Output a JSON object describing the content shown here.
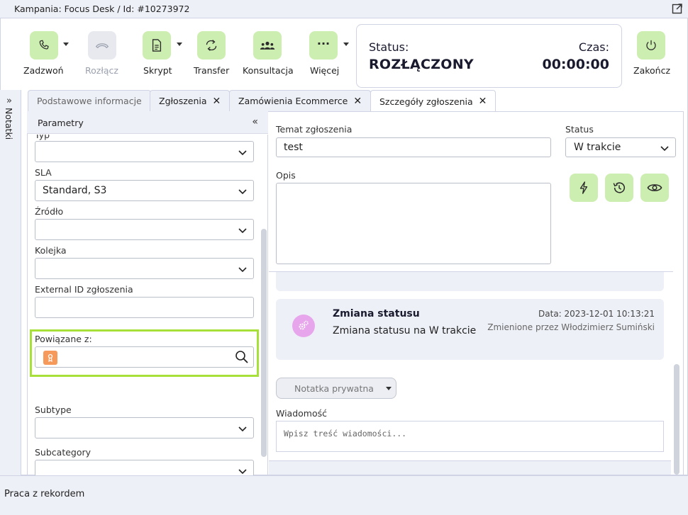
{
  "window": {
    "title": "Kampania: Focus Desk / Id: #10273972"
  },
  "toolbar": {
    "call_label": "Zadzwoń",
    "hangup_label": "Rozłącz",
    "script_label": "Skrypt",
    "transfer_label": "Transfer",
    "consult_label": "Konsultacja",
    "more_label": "Więcej",
    "end_label": "Zakończ"
  },
  "status_box": {
    "status_label": "Status:",
    "status_value": "ROZŁĄCZONY",
    "time_label": "Czas:",
    "time_value": "00:00:00"
  },
  "notes_tab": {
    "label": "Notatki"
  },
  "tabs": [
    {
      "label": "Podstawowe informacje"
    },
    {
      "label": "Zgłoszenia"
    },
    {
      "label": "Zamówienia Ecommerce"
    },
    {
      "label": "Szczegóły zgłoszenia"
    }
  ],
  "params": {
    "title": "Parametry",
    "type_label": "Typ",
    "sla_label": "SLA",
    "sla_value": "Standard, S3",
    "source_label": "Źródło",
    "queue_label": "Kolejka",
    "external_id_label": "External ID zgłoszenia",
    "linked_label": "Powiązane z:",
    "subtype_label": "Subtype",
    "subcategory_label": "Subcategory"
  },
  "ticket": {
    "subject_label": "Temat zgłoszenia",
    "subject_value": "test",
    "status_label": "Status",
    "status_value": "W trakcie",
    "description_label": "Opis"
  },
  "feed": {
    "card_title": "Zmiana statusu",
    "card_text": "Zmiana statusu na W trakcie",
    "card_date": "Data: 2023-12-01 10:13:21",
    "card_author": "Zmienione przez Włodzimierz Sumiński"
  },
  "message": {
    "note_type": "Notatka prywatna",
    "label": "Wiadomość",
    "placeholder": "Wpisz treść wiadomości..."
  },
  "footer": {
    "text": "Praca z rekordem"
  },
  "colors": {
    "accent_green": "#cdeeb1",
    "highlight": "#a8e03a",
    "status_icon_bg": "#e7a5ec",
    "linked_icon_bg": "#f59a5b"
  }
}
